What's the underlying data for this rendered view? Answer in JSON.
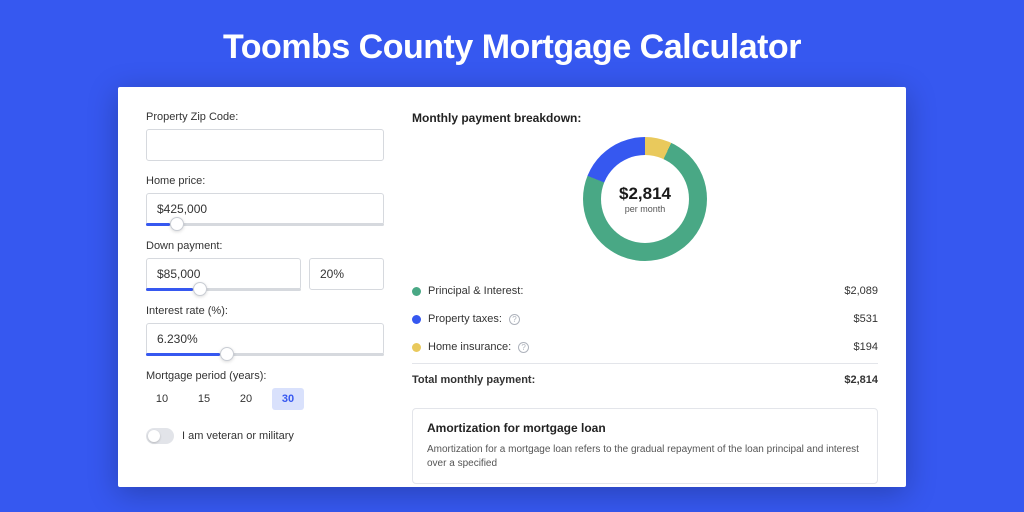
{
  "title": "Toombs County Mortgage Calculator",
  "form": {
    "zip_label": "Property Zip Code:",
    "zip_value": "",
    "price_label": "Home price:",
    "price_value": "$425,000",
    "down_label": "Down payment:",
    "down_value": "$85,000",
    "down_pct": "20%",
    "rate_label": "Interest rate (%):",
    "rate_value": "6.230%",
    "period_label": "Mortgage period (years):",
    "periods": [
      "10",
      "15",
      "20",
      "30"
    ],
    "period_active": "30",
    "veteran_label": "I am veteran or military"
  },
  "breakdown": {
    "title": "Monthly payment breakdown:",
    "center_amount": "$2,814",
    "center_sub": "per month",
    "items": [
      {
        "label": "Principal & Interest:",
        "value": "$2,089",
        "color": "green",
        "info": false
      },
      {
        "label": "Property taxes:",
        "value": "$531",
        "color": "blue",
        "info": true
      },
      {
        "label": "Home insurance:",
        "value": "$194",
        "color": "yellow",
        "info": true
      }
    ],
    "total_label": "Total monthly payment:",
    "total_value": "$2,814"
  },
  "amortization": {
    "title": "Amortization for mortgage loan",
    "text": "Amortization for a mortgage loan refers to the gradual repayment of the loan principal and interest over a specified"
  },
  "chart_data": {
    "type": "pie",
    "title": "Monthly payment breakdown",
    "series": [
      {
        "name": "Principal & Interest",
        "value": 2089,
        "color": "#49a885"
      },
      {
        "name": "Property taxes",
        "value": 531,
        "color": "#3658f0"
      },
      {
        "name": "Home insurance",
        "value": 194,
        "color": "#e9c95c"
      }
    ],
    "total": 2814,
    "unit": "USD per month"
  }
}
